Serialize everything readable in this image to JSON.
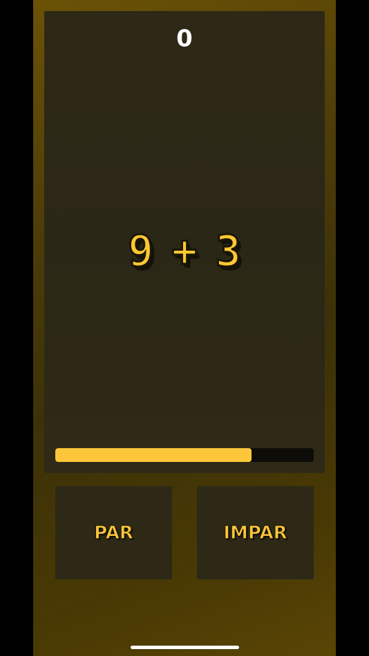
{
  "score": "0",
  "equation": {
    "left_operand": "9",
    "operator": "+",
    "right_operand": "3"
  },
  "timer": {
    "progress_fraction": 0.76,
    "fill_color": "#fdc63b"
  },
  "buttons": {
    "even_label": "PAR",
    "odd_label": "IMPAR"
  },
  "colors": {
    "accent": "#fdc63b",
    "background": "#4e3d08",
    "panel": "#2d2916"
  }
}
